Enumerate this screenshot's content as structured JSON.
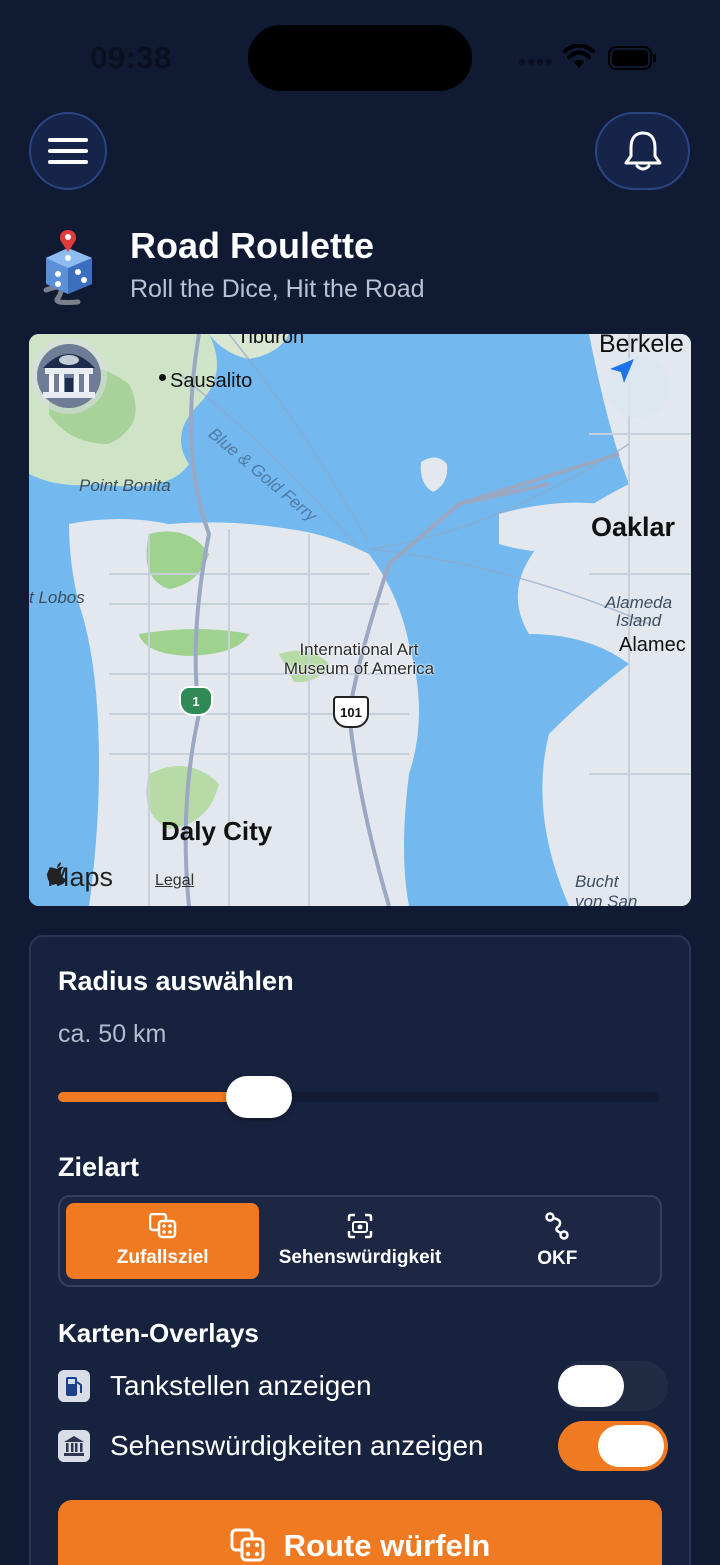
{
  "status_bar": {
    "time": "09:38"
  },
  "header": {
    "app_title": "Road Roulette",
    "app_subtitle": "Roll the Dice, Hit the Road"
  },
  "map": {
    "labels": {
      "tiburon": "Tiburon",
      "sausalito": "Sausalito",
      "ferry": "Blue & Gold Ferry",
      "point_bonita": "Point Bonita",
      "lobos": "t Lobos",
      "berkeley": "Berkele",
      "oakland": "Oaklar",
      "alameda_island": "Alameda\nIsland",
      "alameda": "Alamec",
      "daly_city": "Daly City",
      "bucht": "Bucht\nvon San",
      "route_1": "1",
      "route_101": "101"
    },
    "poi_label": "International Art\nMuseum of America",
    "attribution": "Maps",
    "legal": "Legal"
  },
  "radius": {
    "title": "Radius auswählen",
    "value_text": "ca. 50 km",
    "slider_fraction": 0.24
  },
  "destination": {
    "title": "Zielart",
    "options": [
      {
        "label": "Zufallsziel",
        "icon": "dice-icon",
        "active": true
      },
      {
        "label": "Sehenswürdigkeit",
        "icon": "camera-icon",
        "active": false
      },
      {
        "label": "OKF",
        "icon": "route-icon",
        "active": false
      }
    ]
  },
  "overlays": {
    "title": "Karten-Overlays",
    "items": [
      {
        "label": "Tankstellen anzeigen",
        "icon": "fuel-pump-icon",
        "on": false
      },
      {
        "label": "Sehenswürdigkeiten anzeigen",
        "icon": "landmark-icon",
        "on": true
      }
    ]
  },
  "action": {
    "label": "Route würfeln"
  },
  "colors": {
    "accent": "#f07a22",
    "background": "#101a33",
    "panel": "#17223f"
  }
}
